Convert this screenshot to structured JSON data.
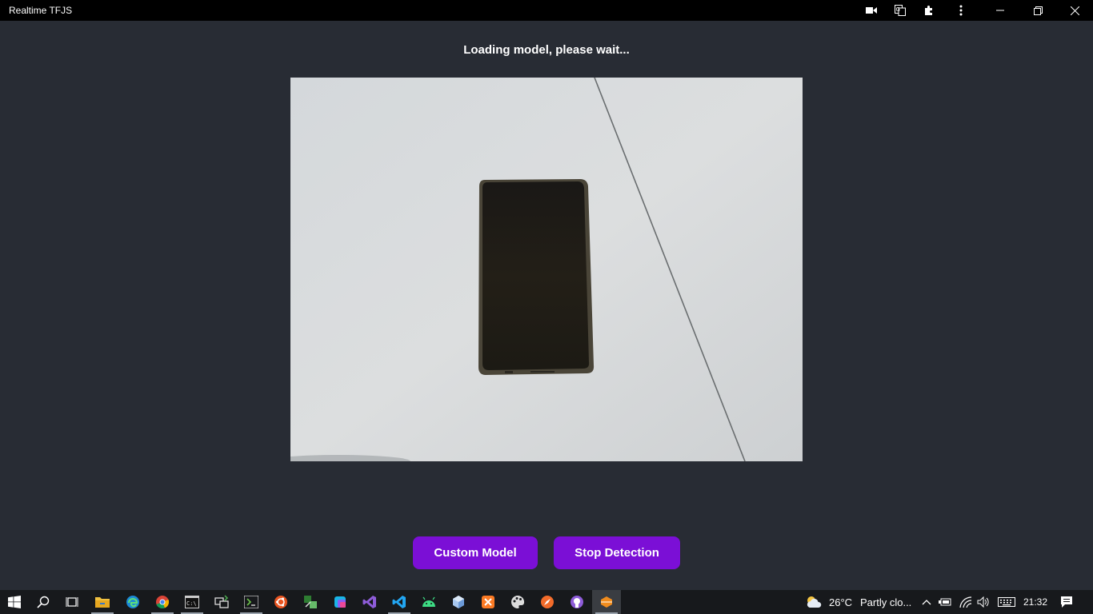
{
  "window": {
    "title": "Realtime TFJS",
    "icons": [
      "camera-icon",
      "translate-icon",
      "extensions-icon",
      "more-icon",
      "minimize-icon",
      "restore-icon",
      "close-icon"
    ]
  },
  "main": {
    "status": "Loading model, please wait...",
    "buttons": {
      "custom_model": "Custom Model",
      "stop_detection": "Stop Detection"
    },
    "accent": "#7b0fd6",
    "background": "#282c34"
  },
  "taskbar": {
    "apps": [
      "windows-start-icon",
      "search-icon",
      "task-view-icon",
      "file-explorer-icon",
      "edge-icon",
      "chrome-icon",
      "terminal-icon",
      "remote-icon",
      "editor-icon",
      "ubuntu-icon",
      "tool-icon",
      "cube-icon",
      "visual-studio-icon",
      "vscode-icon",
      "android-icon",
      "box-icon",
      "xampp-icon",
      "paint-icon",
      "compass-icon",
      "github-icon",
      "app-icon"
    ],
    "weather": {
      "temp": "26°C",
      "desc": "Partly clo..."
    },
    "clock": "21:32"
  }
}
